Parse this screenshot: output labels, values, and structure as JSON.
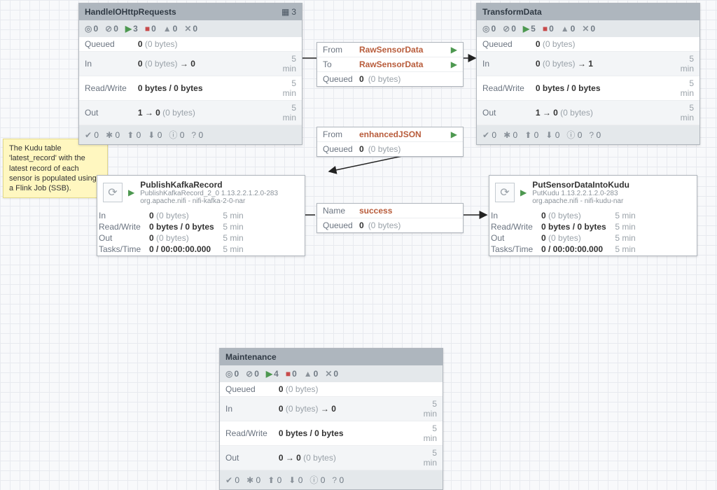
{
  "note": {
    "text": "The Kudu table 'latest_record' with the latest record of each sensor is populated using a Flink Job (SSB)."
  },
  "timeLabel": "5 min",
  "pg_handle": {
    "title": "HandleIOHttpRequests",
    "badge": "3",
    "status": {
      "disabled": "0",
      "invalid": "0",
      "run": "3",
      "stop": "0",
      "warn": "0",
      "tool": "0"
    },
    "rows": {
      "queued": {
        "lbl": "Queued",
        "val": "0",
        "bytes": "(0 bytes)"
      },
      "in": {
        "lbl": "In",
        "val": "0",
        "bytes": "(0 bytes)",
        "arrow": "→ 0"
      },
      "rw": {
        "lbl": "Read/Write",
        "val": "0 bytes / 0 bytes"
      },
      "out": {
        "lbl": "Out",
        "val": "1 → 0",
        "bytes": "(0 bytes)"
      }
    },
    "footer": {
      "check": "0",
      "star": "0",
      "up": "0",
      "ru": "0",
      "info": "0",
      "q": "0"
    }
  },
  "pg_transform": {
    "title": "TransformData",
    "status": {
      "disabled": "0",
      "invalid": "0",
      "run": "5",
      "stop": "0",
      "warn": "0",
      "tool": "0"
    },
    "rows": {
      "queued": {
        "lbl": "Queued",
        "val": "0",
        "bytes": "(0 bytes)"
      },
      "in": {
        "lbl": "In",
        "val": "0",
        "bytes": "(0 bytes)",
        "arrow": "→ 1"
      },
      "rw": {
        "lbl": "Read/Write",
        "val": "0 bytes / 0 bytes"
      },
      "out": {
        "lbl": "Out",
        "val": "1 → 0",
        "bytes": "(0 bytes)"
      }
    },
    "footer": {
      "check": "0",
      "star": "0",
      "up": "0",
      "ru": "0",
      "info": "0",
      "q": "0"
    }
  },
  "pg_maint": {
    "title": "Maintenance",
    "status": {
      "disabled": "0",
      "invalid": "0",
      "run": "4",
      "stop": "0",
      "warn": "0",
      "tool": "0"
    },
    "rows": {
      "queued": {
        "lbl": "Queued",
        "val": "0",
        "bytes": "(0 bytes)"
      },
      "in": {
        "lbl": "In",
        "val": "0",
        "bytes": "(0 bytes)",
        "arrow": "→ 0"
      },
      "rw": {
        "lbl": "Read/Write",
        "val": "0 bytes / 0 bytes"
      },
      "out": {
        "lbl": "Out",
        "val": "0 → 0",
        "bytes": "(0 bytes)"
      }
    },
    "footer": {
      "check": "0",
      "star": "0",
      "up": "0",
      "ru": "0",
      "info": "0",
      "q": "0"
    }
  },
  "proc_kafka": {
    "name": "PublishKafkaRecord",
    "sub1": "PublishKafkaRecord_2_0 1.13.2.2.1.2.0-283",
    "sub2": "org.apache.nifi - nifi-kafka-2-0-nar",
    "rows": {
      "in": {
        "lbl": "In",
        "val": "0",
        "bytes": "(0 bytes)"
      },
      "rw": {
        "lbl": "Read/Write",
        "val": "0 bytes / 0 bytes"
      },
      "out": {
        "lbl": "Out",
        "val": "0",
        "bytes": "(0 bytes)"
      },
      "tt": {
        "lbl": "Tasks/Time",
        "val": "0 / 00:00:00.000"
      }
    }
  },
  "proc_kudu": {
    "name": "PutSensorDataIntoKudu",
    "sub1": "PutKudu 1.13.2.2.1.2.0-283",
    "sub2": "org.apache.nifi - nifi-kudu-nar",
    "rows": {
      "in": {
        "lbl": "In",
        "val": "0",
        "bytes": "(0 bytes)"
      },
      "rw": {
        "lbl": "Read/Write",
        "val": "0 bytes / 0 bytes"
      },
      "out": {
        "lbl": "Out",
        "val": "0",
        "bytes": "(0 bytes)"
      },
      "tt": {
        "lbl": "Tasks/Time",
        "val": "0 / 00:00:00.000"
      }
    }
  },
  "conn_raw": {
    "from": {
      "lbl": "From",
      "val": "RawSensorData"
    },
    "to": {
      "lbl": "To",
      "val": "RawSensorData"
    },
    "q": {
      "lbl": "Queued",
      "val": "0",
      "bytes": "(0 bytes)"
    }
  },
  "conn_enh": {
    "from": {
      "lbl": "From",
      "val": "enhancedJSON"
    },
    "q": {
      "lbl": "Queued",
      "val": "0",
      "bytes": "(0 bytes)"
    }
  },
  "conn_succ": {
    "name": {
      "lbl": "Name",
      "val": "success"
    },
    "q": {
      "lbl": "Queued",
      "val": "0",
      "bytes": "(0 bytes)"
    }
  }
}
